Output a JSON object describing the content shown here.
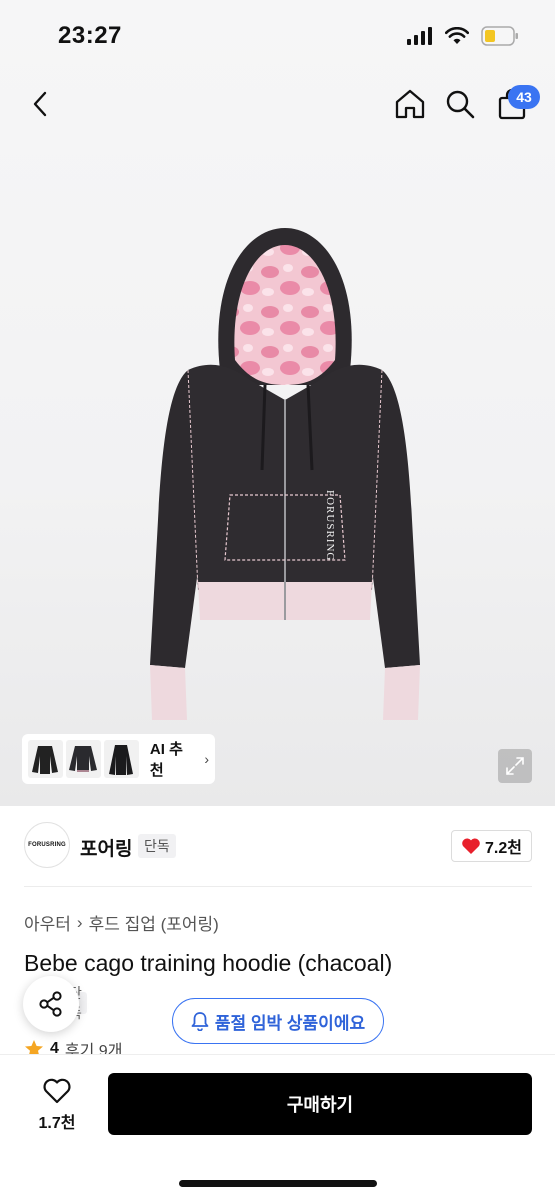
{
  "status_bar": {
    "time": "23:27",
    "icons": [
      "signal-icon",
      "wifi-icon",
      "battery-icon"
    ]
  },
  "nav": {
    "back_icon": "chevron-left-icon",
    "home_icon": "home-icon",
    "search_icon": "search-icon",
    "cart_icon": "shopping-bag-icon",
    "cart_count": "43"
  },
  "colors": {
    "accent_blue": "#3a74f2",
    "heart_red": "#e8202c",
    "star_orange": "#f5a623",
    "buy_button": "#000000"
  },
  "ai_recommend": {
    "label": "AI 추천",
    "chevron": "›"
  },
  "brand": {
    "logo_text": "FORUSRING",
    "name": "포어링",
    "badge": "단독",
    "like_count": "7.2천"
  },
  "breadcrumb": {
    "category": "아우터",
    "separator": "›",
    "subcategory": "후드 집업 (포어링)"
  },
  "product": {
    "title": "Bebe cago training hoodie (chacoal)",
    "badge": "단독",
    "rating": "4",
    "reviews": "후기 9개",
    "print_text": "FORUSRING"
  },
  "restock": {
    "label": "품절 임박 상품이에요"
  },
  "bottom": {
    "fav_count": "1.7천",
    "buy_label": "구매하기"
  }
}
